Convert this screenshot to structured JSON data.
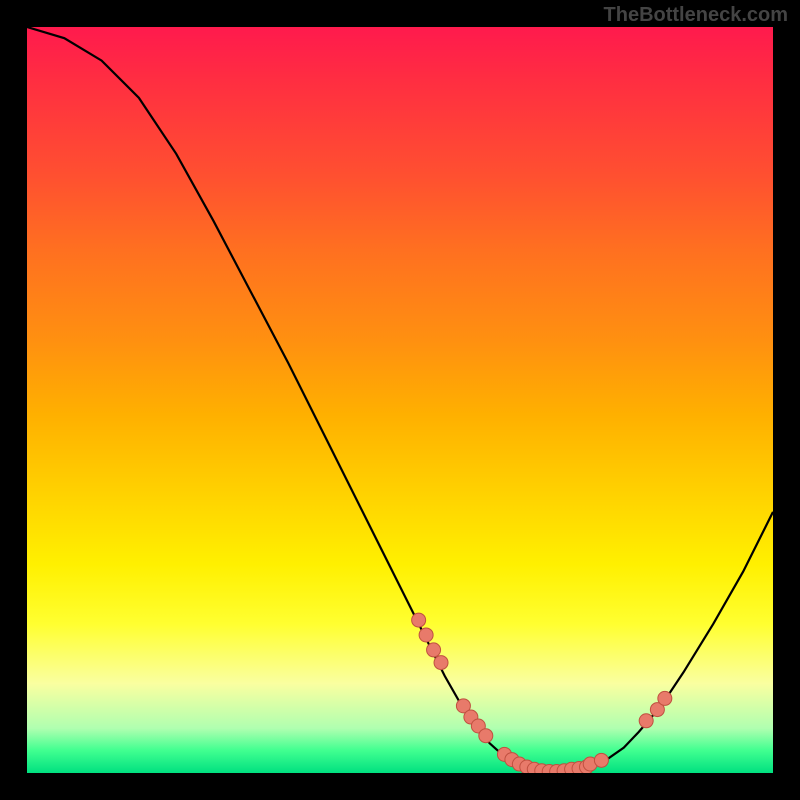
{
  "watermark": "TheBottleneck.com",
  "chart_data": {
    "type": "line",
    "title": "",
    "xlabel": "",
    "ylabel": "",
    "xlim": [
      0,
      1
    ],
    "ylim": [
      0,
      1
    ],
    "curve": [
      {
        "x": 0.0,
        "y": 1.0
      },
      {
        "x": 0.05,
        "y": 0.985
      },
      {
        "x": 0.1,
        "y": 0.955
      },
      {
        "x": 0.15,
        "y": 0.905
      },
      {
        "x": 0.2,
        "y": 0.83
      },
      {
        "x": 0.25,
        "y": 0.74
      },
      {
        "x": 0.3,
        "y": 0.645
      },
      {
        "x": 0.35,
        "y": 0.55
      },
      {
        "x": 0.4,
        "y": 0.45
      },
      {
        "x": 0.45,
        "y": 0.35
      },
      {
        "x": 0.5,
        "y": 0.25
      },
      {
        "x": 0.53,
        "y": 0.19
      },
      {
        "x": 0.56,
        "y": 0.13
      },
      {
        "x": 0.58,
        "y": 0.095
      },
      {
        "x": 0.6,
        "y": 0.065
      },
      {
        "x": 0.62,
        "y": 0.04
      },
      {
        "x": 0.64,
        "y": 0.022
      },
      {
        "x": 0.66,
        "y": 0.01
      },
      {
        "x": 0.68,
        "y": 0.004
      },
      {
        "x": 0.7,
        "y": 0.002
      },
      {
        "x": 0.72,
        "y": 0.002
      },
      {
        "x": 0.74,
        "y": 0.004
      },
      {
        "x": 0.76,
        "y": 0.01
      },
      {
        "x": 0.78,
        "y": 0.02
      },
      {
        "x": 0.8,
        "y": 0.034
      },
      {
        "x": 0.82,
        "y": 0.055
      },
      {
        "x": 0.85,
        "y": 0.09
      },
      {
        "x": 0.88,
        "y": 0.135
      },
      {
        "x": 0.92,
        "y": 0.2
      },
      {
        "x": 0.96,
        "y": 0.27
      },
      {
        "x": 1.0,
        "y": 0.35
      }
    ],
    "markers": [
      {
        "x": 0.525,
        "y": 0.205
      },
      {
        "x": 0.535,
        "y": 0.185
      },
      {
        "x": 0.545,
        "y": 0.165
      },
      {
        "x": 0.555,
        "y": 0.148
      },
      {
        "x": 0.585,
        "y": 0.09
      },
      {
        "x": 0.595,
        "y": 0.075
      },
      {
        "x": 0.605,
        "y": 0.063
      },
      {
        "x": 0.615,
        "y": 0.05
      },
      {
        "x": 0.64,
        "y": 0.025
      },
      {
        "x": 0.65,
        "y": 0.018
      },
      {
        "x": 0.66,
        "y": 0.012
      },
      {
        "x": 0.67,
        "y": 0.008
      },
      {
        "x": 0.68,
        "y": 0.005
      },
      {
        "x": 0.69,
        "y": 0.003
      },
      {
        "x": 0.7,
        "y": 0.002
      },
      {
        "x": 0.71,
        "y": 0.002
      },
      {
        "x": 0.72,
        "y": 0.003
      },
      {
        "x": 0.73,
        "y": 0.005
      },
      {
        "x": 0.74,
        "y": 0.006
      },
      {
        "x": 0.75,
        "y": 0.008
      },
      {
        "x": 0.755,
        "y": 0.012
      },
      {
        "x": 0.77,
        "y": 0.017
      },
      {
        "x": 0.83,
        "y": 0.07
      },
      {
        "x": 0.845,
        "y": 0.085
      },
      {
        "x": 0.855,
        "y": 0.1
      }
    ],
    "marker_radius": 7,
    "curve_color": "#000000",
    "marker_color": "#e87a6a"
  }
}
